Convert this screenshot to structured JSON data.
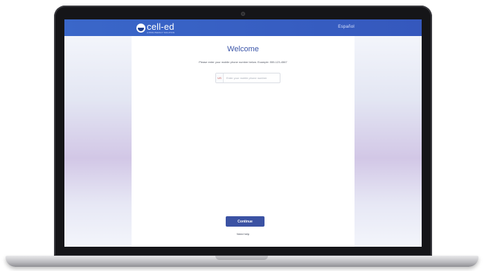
{
  "header": {
    "logo_text": "cell-ed",
    "logo_subtext": "A PROLITERACY SOLUTION",
    "link_label": "Español"
  },
  "main": {
    "title": "Welcome",
    "instructions": "Please enter your mobile phone number below. Example: 555-123-4567",
    "phone": {
      "country_flag": "US",
      "placeholder": "Enter your mobile phone number",
      "value": ""
    },
    "continue_label": "Continue",
    "footer_link": "Need help"
  },
  "colors": {
    "header": "#3a67c9",
    "accent": "#3a54a8",
    "button": "#3b52a3"
  },
  "icons": {
    "logo": "cell-ed-logo-icon",
    "country": "us-flag-icon"
  }
}
